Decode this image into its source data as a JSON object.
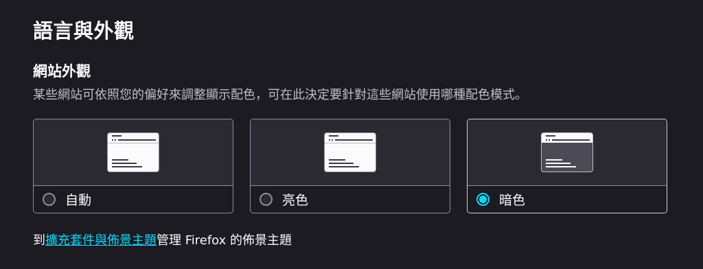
{
  "section_title": "語言與外觀",
  "appearance": {
    "title": "網站外觀",
    "description": "某些網站可依照您的偏好來調整顯示配色，可在此決定要針對這些網站使用哪種配色模式。",
    "options": [
      {
        "label": "自動",
        "selected": false,
        "preview": "light"
      },
      {
        "label": "亮色",
        "selected": false,
        "preview": "light"
      },
      {
        "label": "暗色",
        "selected": true,
        "preview": "dark"
      }
    ]
  },
  "footer": {
    "prefix": "到",
    "link": "擴充套件與佈景主題",
    "suffix": "管理 Firefox 的佈景主題"
  },
  "colors": {
    "background": "#1c1b22",
    "accent": "#00ddff",
    "card_border": "#8f8f9d"
  }
}
